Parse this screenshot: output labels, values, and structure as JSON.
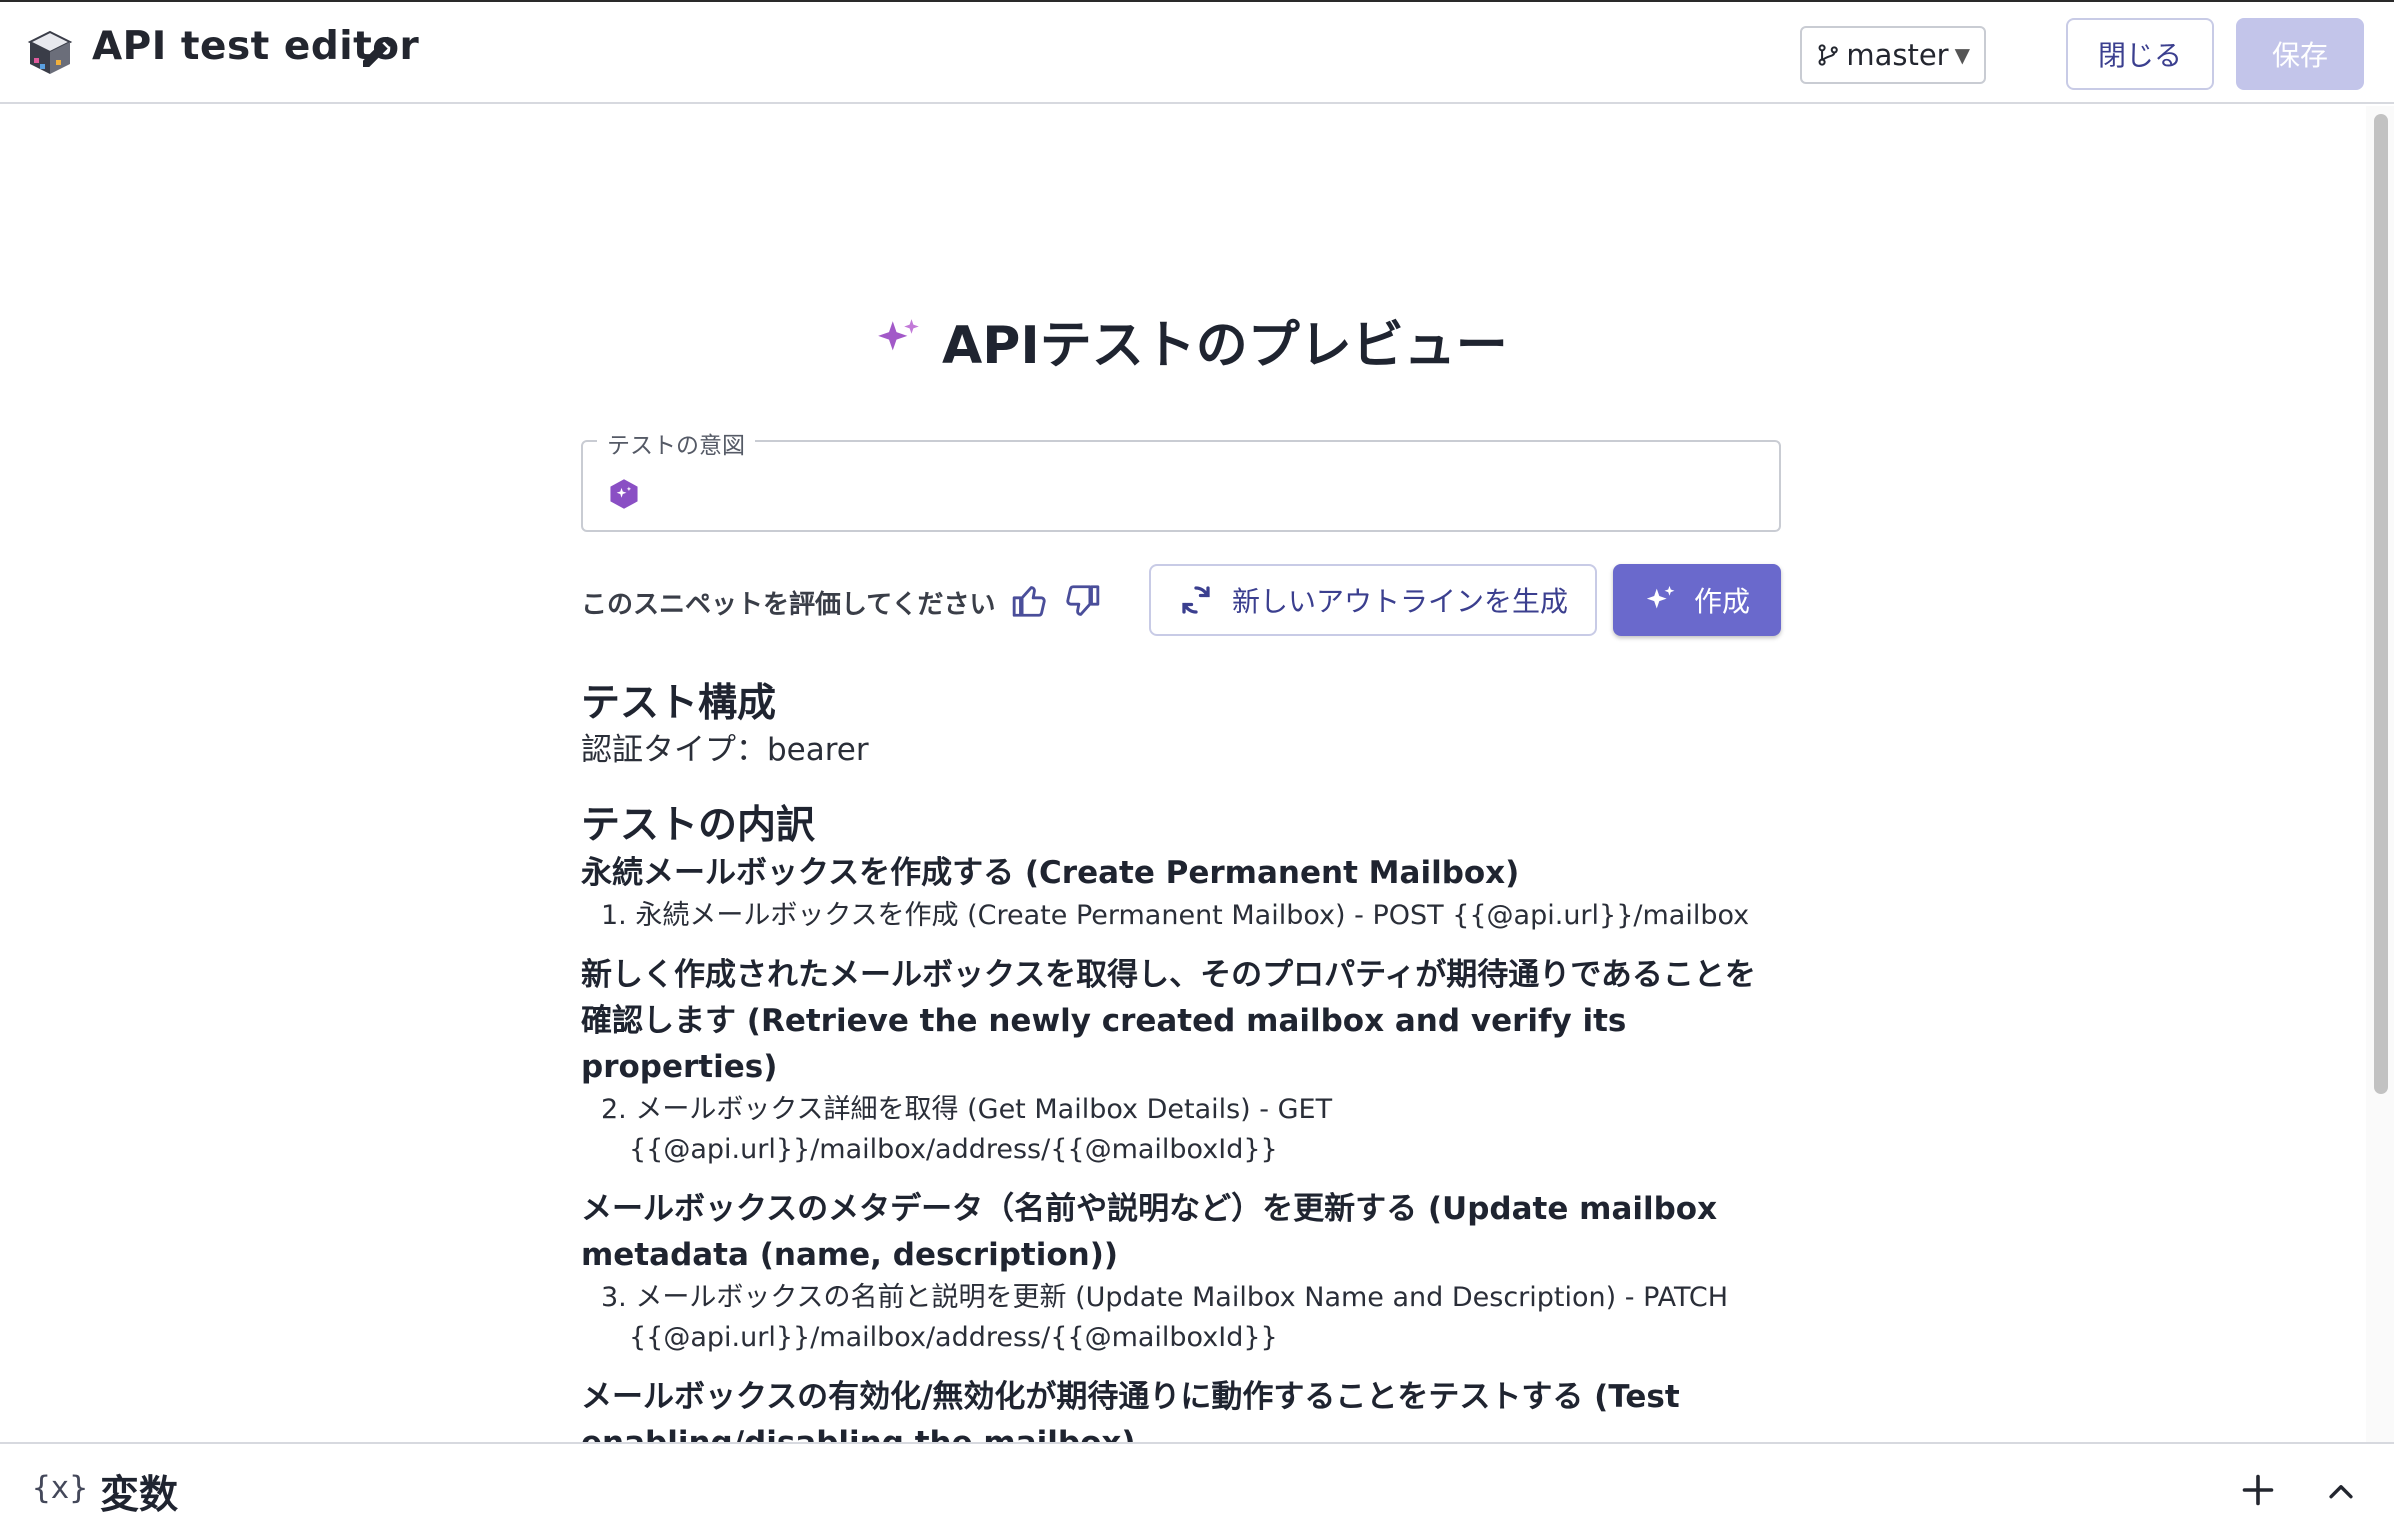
{
  "header": {
    "title": "API test editor",
    "branch": "master",
    "close_label": "閉じる",
    "save_label": "保存"
  },
  "preview": {
    "title": "APIテストのプレビュー",
    "intent_label": "テストの意図",
    "intent_value": "",
    "rate_label": "このスニペットを評価してください",
    "regen_label": "新しいアウトラインを生成",
    "create_label": "作成"
  },
  "config": {
    "heading": "テスト構成",
    "auth": "認証タイプ：bearer"
  },
  "breakdown": {
    "heading": "テストの内訳",
    "sections": [
      {
        "title": "永続メールボックスを作成する (Create Permanent Mailbox)",
        "step": "1. 永続メールボックスを作成 (Create Permanent Mailbox) - POST {{@api.url}}/mailbox"
      },
      {
        "title": "新しく作成されたメールボックスを取得し、そのプロパティが期待通りであることを確認します (Retrieve the newly created mailbox and verify its properties)",
        "step": "2. メールボックス詳細を取得 (Get Mailbox Details) - GET {{@api.url}}/mailbox/address/{{@mailboxId}}"
      },
      {
        "title": "メールボックスのメタデータ（名前や説明など）を更新する (Update mailbox metadata (name, description))",
        "step": "3. メールボックスの名前と説明を更新 (Update Mailbox Name and Description) - PATCH {{@api.url}}/mailbox/address/{{@mailboxId}}"
      },
      {
        "title": "メールボックスの有効化/無効化が期待通りに動作することをテストする (Test enabling/disabling the mailbox)",
        "step": ""
      }
    ]
  },
  "variables": {
    "icon_text": "{x}",
    "title": "変数"
  },
  "colors": {
    "accent": "#6a69cc",
    "accent_disabled": "#c3c5ea",
    "sparkle": "#a259c8"
  }
}
